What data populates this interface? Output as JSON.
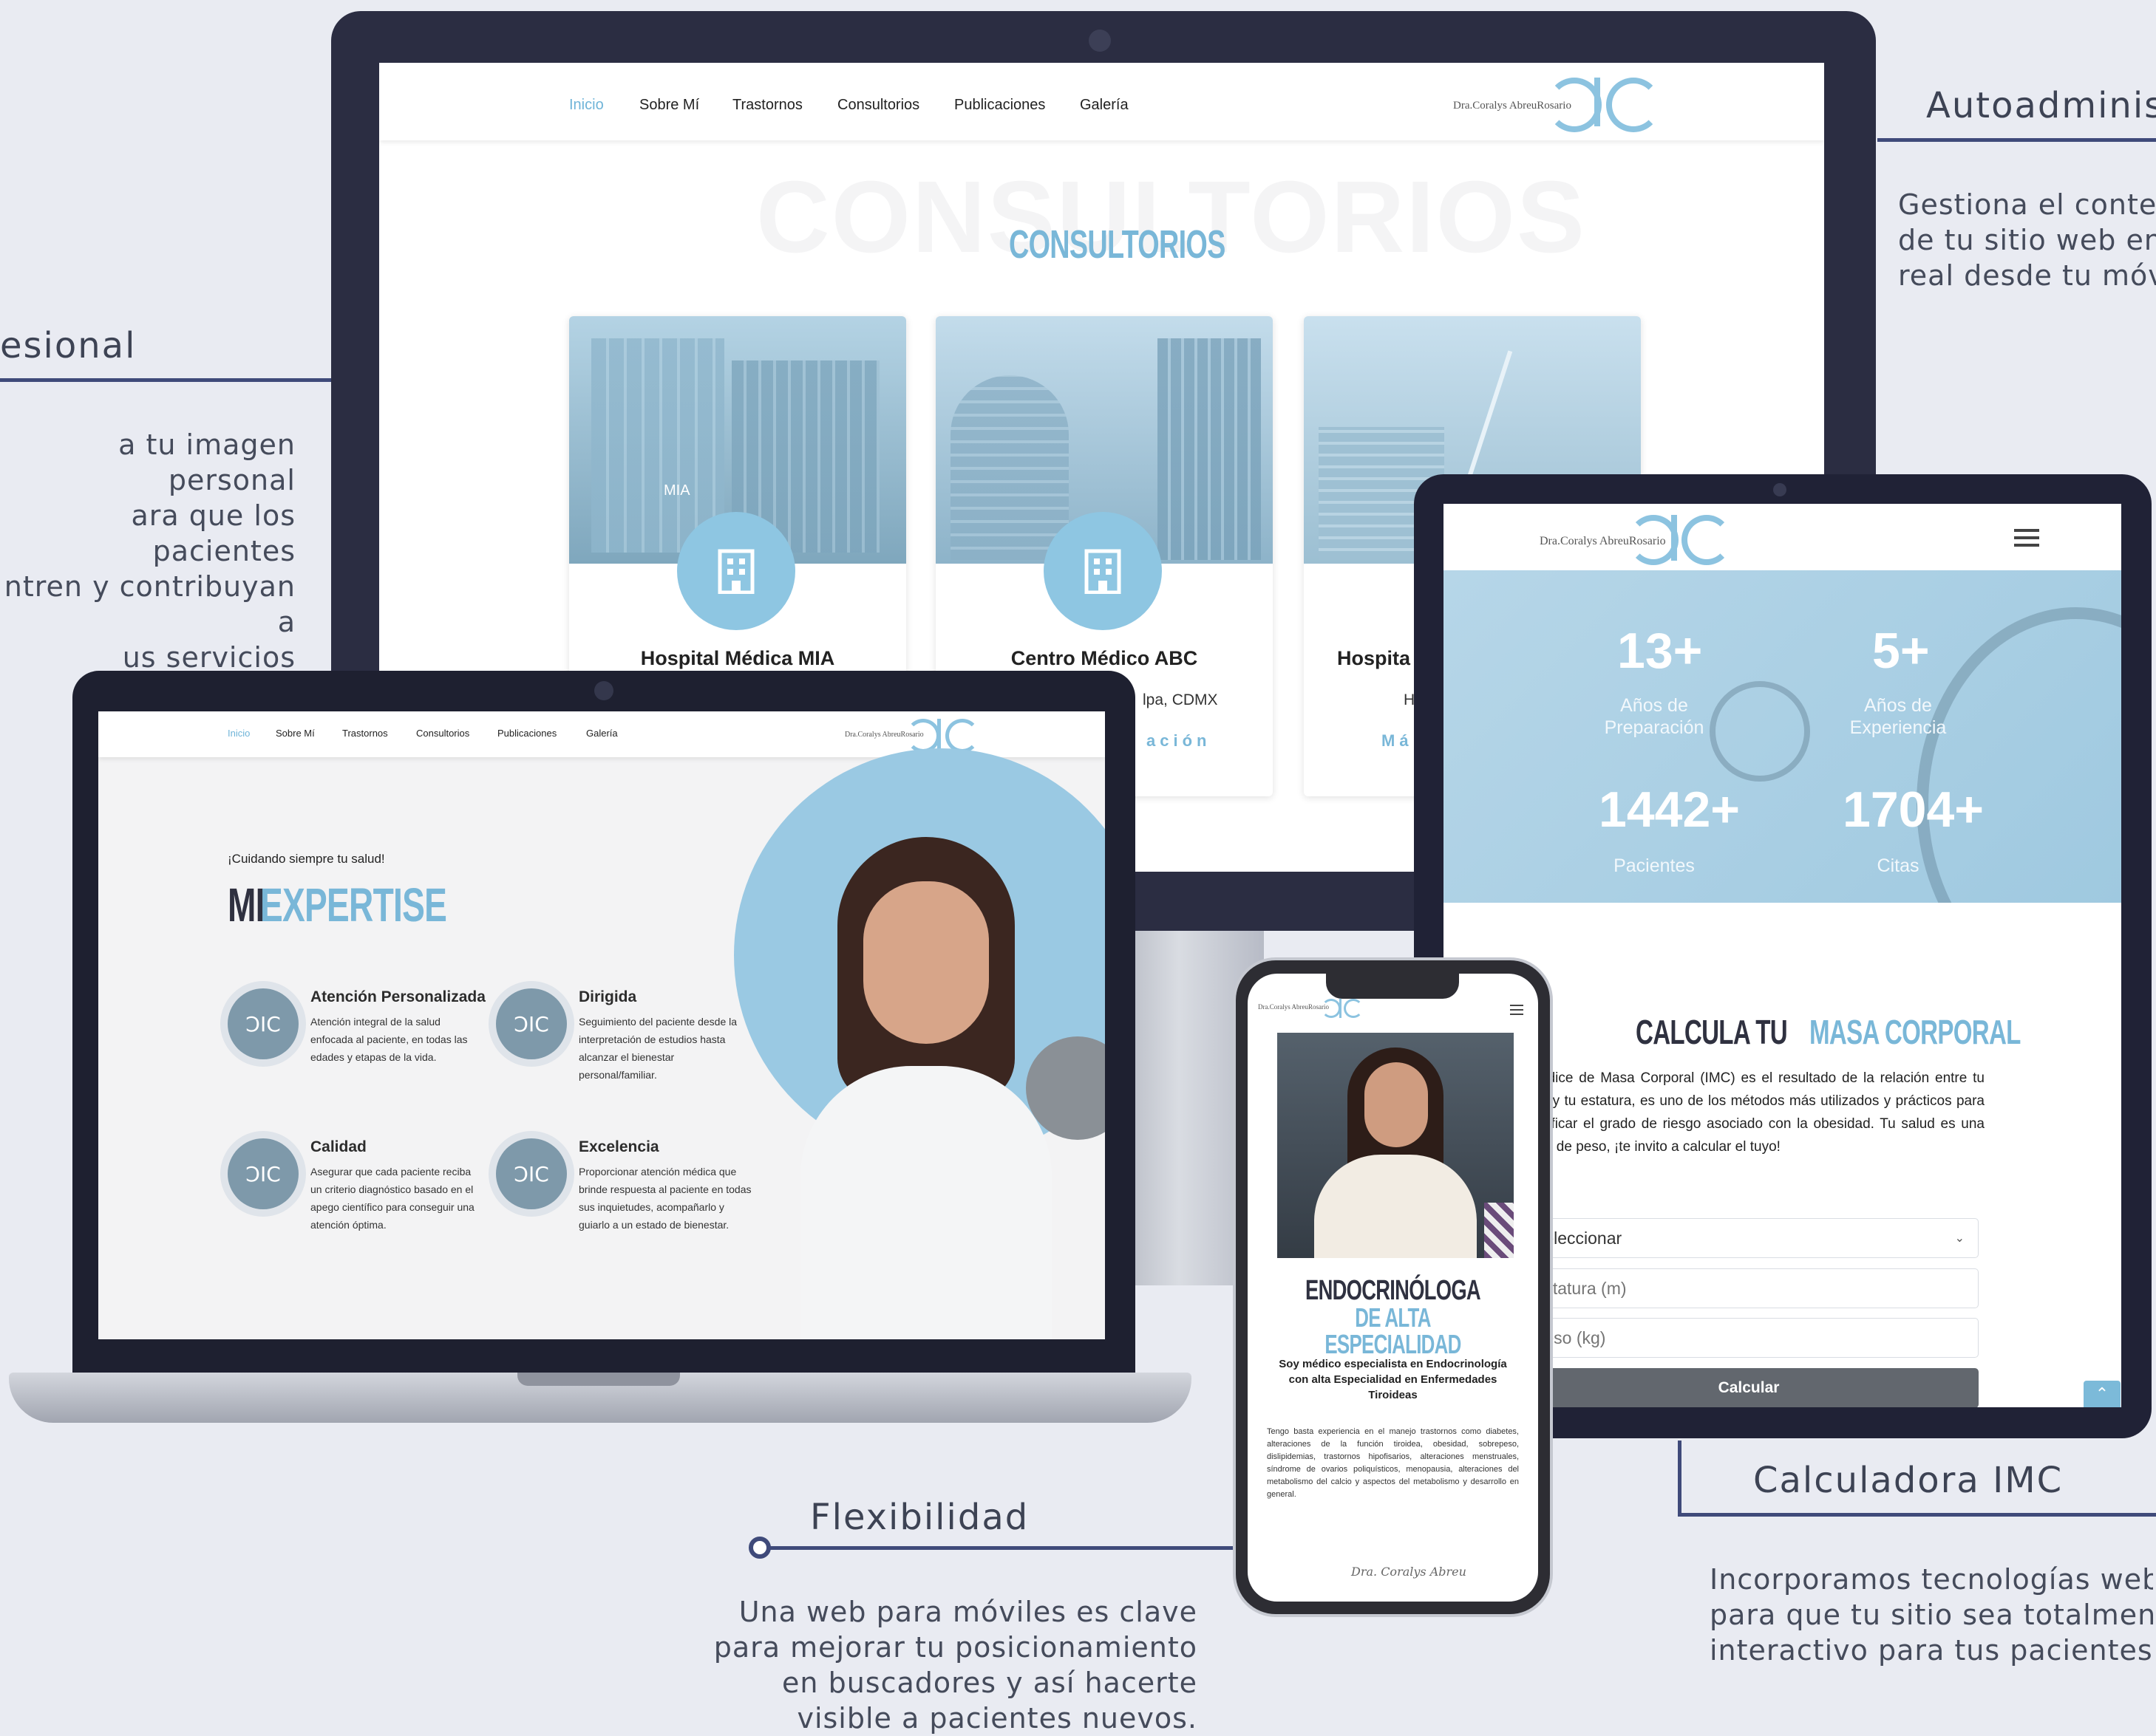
{
  "annotations": {
    "top_right": {
      "title": "Autoadminis",
      "text": [
        "Gestiona el conter",
        "de tu sitio web en",
        "real desde tu móv"
      ]
    },
    "left": {
      "title": "esional",
      "text": [
        "a tu imagen personal",
        "ara que los pacientes",
        "ntren y contribuyan a",
        "us servicios médicos."
      ]
    },
    "bottom_center": {
      "title": "Flexibilidad",
      "text": [
        "Una web para móviles es clave",
        "para mejorar tu posicionamiento",
        "en buscadores y así hacerte",
        "visible a pacientes nuevos."
      ]
    },
    "bottom_right": {
      "title": "Calculadora IMC",
      "text": [
        "Incorporamos tecnologías web",
        "para que tu sitio sea totalmente",
        "interactivo para tus pacientes."
      ]
    }
  },
  "nav": {
    "items": [
      "Inicio",
      "Sobre Mí",
      "Trastornos",
      "Consultorios",
      "Publicaciones",
      "Galería"
    ],
    "active": "Inicio",
    "brand": "Dra.Coralys AbreuRosario"
  },
  "monitor": {
    "watermark": "CONSULTORIOS",
    "heading": "CONSULTORIOS",
    "cards": [
      {
        "name": "Hospital Médica MIA",
        "sign": "MIA"
      },
      {
        "name": "Centro Médico ABC",
        "location": "lpa, CDMX",
        "more": "ación"
      },
      {
        "name": "Hospita",
        "location": "H",
        "more": "Má"
      }
    ]
  },
  "laptop": {
    "tagline": "¡Cuidando siempre tu salud!",
    "heading_a": "MI",
    "heading_b": "EXPERTISE",
    "items": [
      {
        "title": "Atención Personalizada",
        "desc": "Atención integral de la salud enfocada al paciente, en todas las edades y etapas de la vida."
      },
      {
        "title": "Dirigida",
        "desc": "Seguimiento del paciente desde la interpretación de estudios hasta alcanzar el bienestar personal/familiar."
      },
      {
        "title": "Calidad",
        "desc": "Asegurar que cada paciente reciba un criterio diagnóstico basado en el apego científico para conseguir una atención óptima."
      },
      {
        "title": "Excelencia",
        "desc": "Proporcionar atención médica que brinde respuesta al paciente en todas sus inquietudes, acompañarlo y guiarlo a un estado de bienestar."
      }
    ],
    "icon_glyph": "ƆIC"
  },
  "tablet": {
    "stats": [
      {
        "num": "13+",
        "label": [
          "Años de",
          "Preparación"
        ]
      },
      {
        "num": "5+",
        "label": [
          "Años de",
          "Experiencia"
        ]
      },
      {
        "num": "1442+",
        "label": [
          "Pacientes"
        ]
      },
      {
        "num": "1704+",
        "label": [
          "Citas"
        ]
      }
    ],
    "calc_title_a": "CALCULA TU",
    "calc_title_b": "MASA CORPORAL",
    "calc_desc": "El Índice de Masa Corporal (IMC) es el resultado de la relación entre tu peso y tu estatura, es uno de los métodos más utilizados y prácticos para identificar el grado de riesgo asociado con la obesidad. Tu salud es una razón de peso, ¡te invito a calcular el tuyo!",
    "select_value": "Seleccionar",
    "height_placeholder": "Estatura (m)",
    "weight_placeholder": "Peso (kg)",
    "button": "Calcular"
  },
  "phone": {
    "brand": "Dra.Coralys AbreuRosario",
    "heading_a": "ENDOCRINÓLOGA",
    "heading_b": "DE ALTA ESPECIALIDAD",
    "subtitle": "Soy médico especialista en Endocrinología con alta Especialidad en Enfermedades Tiroideas",
    "body": "Tengo basta experiencia en el manejo trastornos como diabetes, alteraciones de la función tiroidea, obesidad, sobrepeso, dislipidemias, trastornos hipofisarios, alteraciones menstruales, síndrome de ovarios poliquísticos, menopausia, alteraciones del metabolismo del calcio y aspectos del metabolismo y desarrollo en general.",
    "signature": "Dra. Coralys Abreu"
  },
  "colors": {
    "accent": "#7cbad9",
    "navy": "#2b2d42",
    "line": "#3f4a7a"
  }
}
